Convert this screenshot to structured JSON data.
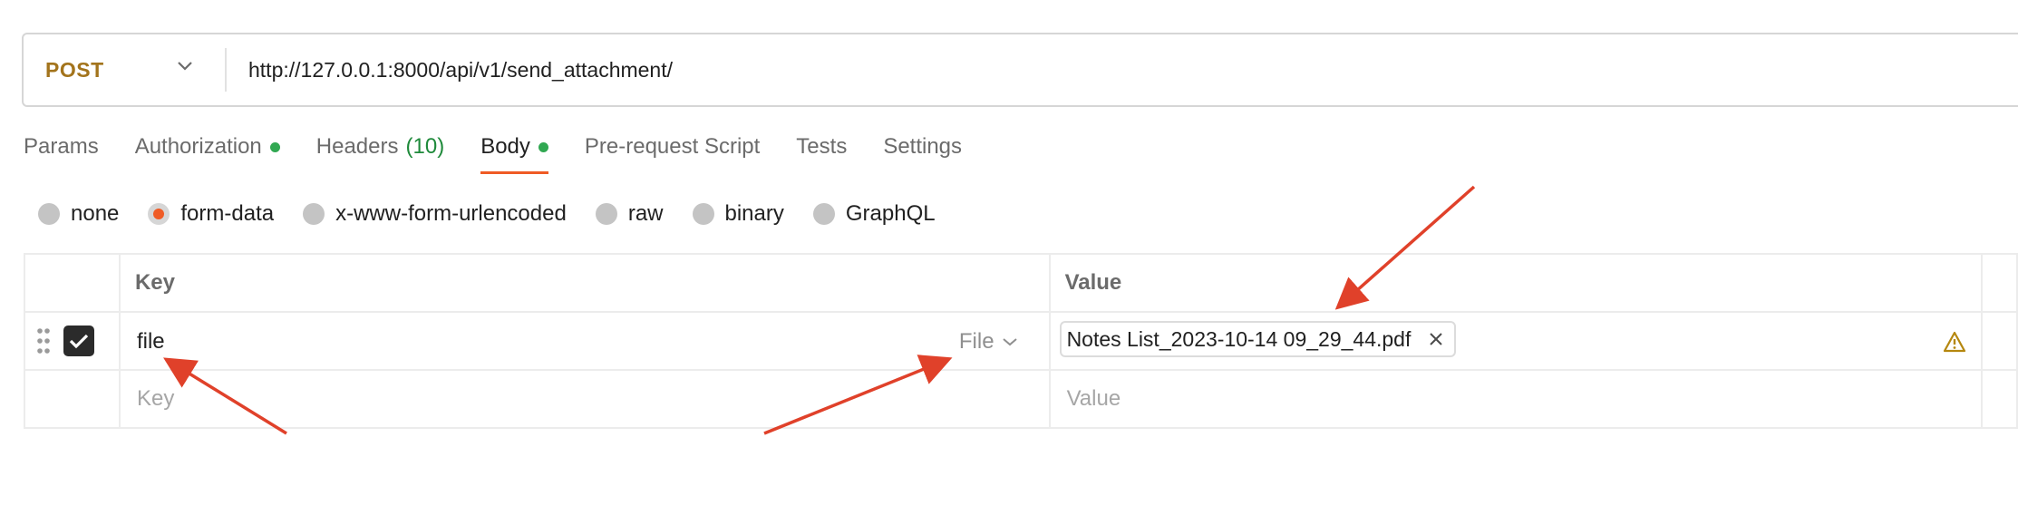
{
  "request": {
    "method": "POST",
    "url": "http://127.0.0.1:8000/api/v1/send_attachment/"
  },
  "tabs": [
    {
      "label": "Params",
      "dot": false
    },
    {
      "label": "Authorization",
      "dot": true
    },
    {
      "label": "Headers",
      "count": "(10)"
    },
    {
      "label": "Body",
      "dot": true,
      "active": true
    },
    {
      "label": "Pre-request Script"
    },
    {
      "label": "Tests"
    },
    {
      "label": "Settings"
    }
  ],
  "body_modes": [
    {
      "label": "none",
      "selected": false
    },
    {
      "label": "form-data",
      "selected": true
    },
    {
      "label": "x-www-form-urlencoded",
      "selected": false
    },
    {
      "label": "raw",
      "selected": false
    },
    {
      "label": "binary",
      "selected": false
    },
    {
      "label": "GraphQL",
      "selected": false
    }
  ],
  "table": {
    "headers": {
      "key": "Key",
      "value": "Value"
    },
    "rows": [
      {
        "key": "file",
        "type": "File",
        "value": "Notes List_2023-10-14 09_29_44.pdf",
        "enabled": true
      }
    ],
    "placeholders": {
      "key": "Key",
      "value": "Value"
    }
  },
  "colors": {
    "method": "#a3741c",
    "accent": "#ef5b25",
    "status_dot": "#31a852",
    "annotation": "#e0412a"
  },
  "icons": {
    "method_dropdown": "chevron-down-icon",
    "drag": "drag-handle-icon",
    "checkbox": "checkmark-icon",
    "type_dropdown": "chevron-down-icon",
    "remove": "close-icon",
    "warning": "warning-icon"
  }
}
